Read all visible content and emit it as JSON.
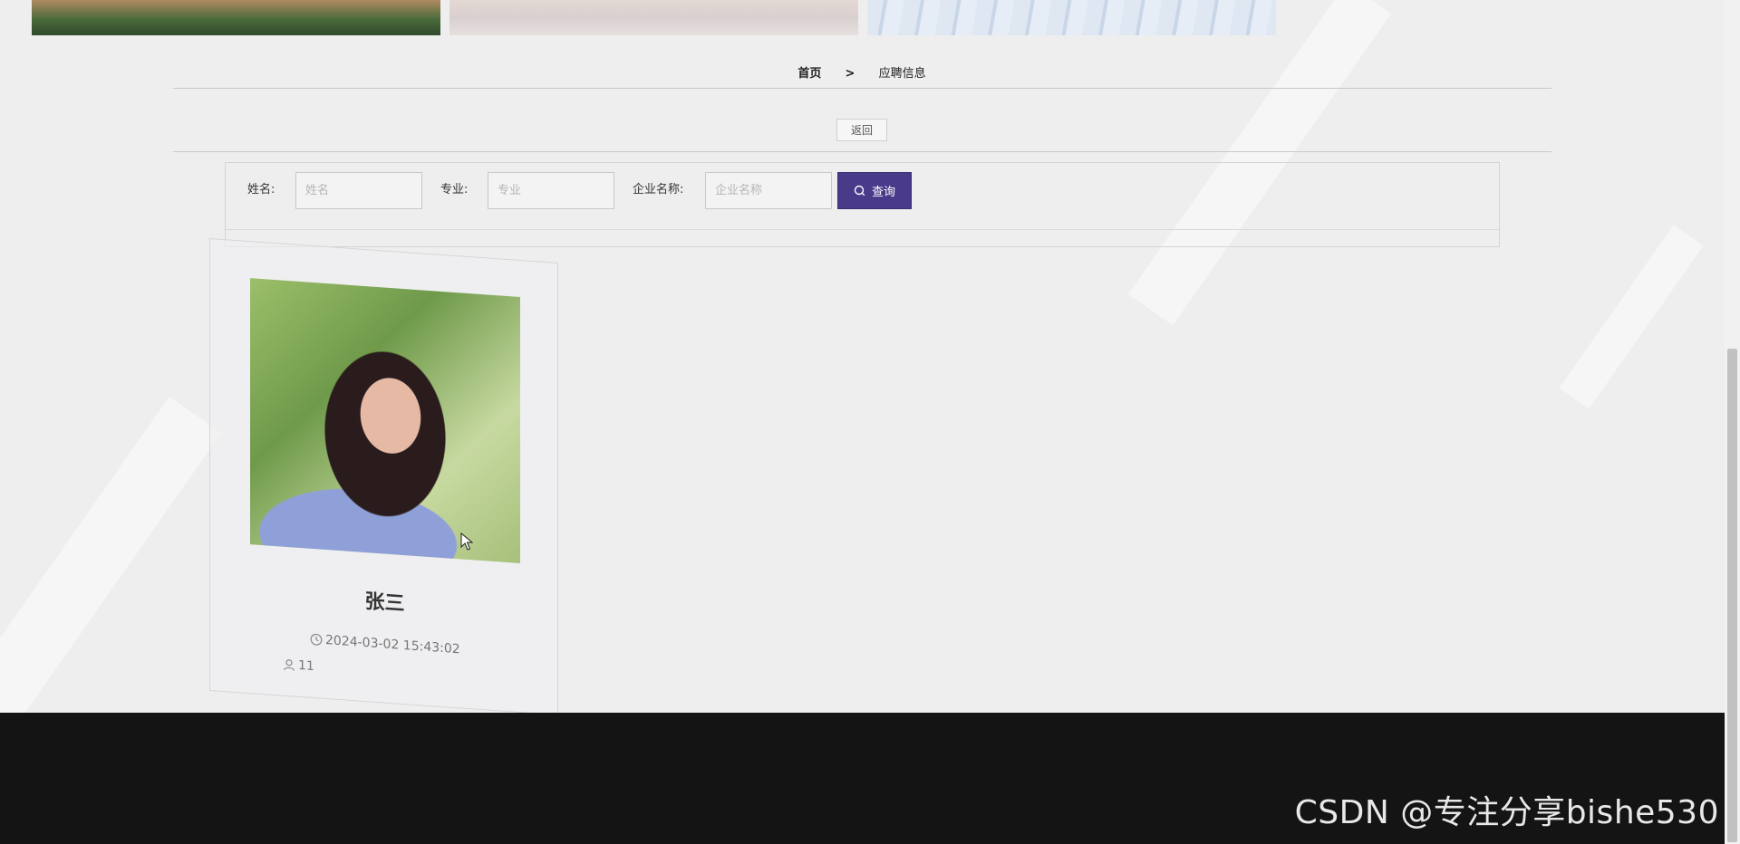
{
  "breadcrumb": {
    "home": "首页",
    "separator": ">",
    "current": "应聘信息"
  },
  "back_button": "返回",
  "search": {
    "name_label": "姓名:",
    "name_placeholder": "姓名",
    "major_label": "专业:",
    "major_placeholder": "专业",
    "company_label": "企业名称:",
    "company_placeholder": "企业名称",
    "query_button": "查询",
    "query_icon": "search-icon"
  },
  "cards": [
    {
      "name": "张三",
      "date": "2024-03-02 15:43:02",
      "count": "11",
      "date_icon": "clock-icon",
      "count_icon": "user-icon"
    }
  ],
  "watermark": "CSDN @专注分享bishe530",
  "colors": {
    "accent": "#4a3a8a",
    "footer": "#141414",
    "background": "#eeeeef"
  }
}
